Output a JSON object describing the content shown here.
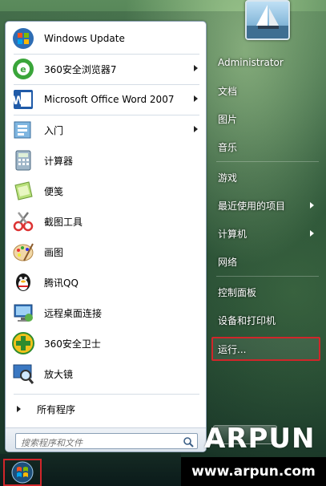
{
  "programs": [
    {
      "label": "Windows Update",
      "icon": "windows-update-icon",
      "has_submenu": false
    },
    {
      "label": "360安全浏览器7",
      "icon": "360-browser-icon",
      "has_submenu": true
    },
    {
      "label": "Microsoft Office Word 2007",
      "icon": "word-icon",
      "has_submenu": true
    },
    {
      "label": "入门",
      "icon": "getting-started-icon",
      "has_submenu": true
    },
    {
      "label": "计算器",
      "icon": "calculator-icon",
      "has_submenu": false
    },
    {
      "label": "便笺",
      "icon": "sticky-notes-icon",
      "has_submenu": false
    },
    {
      "label": "截图工具",
      "icon": "snipping-tool-icon",
      "has_submenu": false
    },
    {
      "label": "画图",
      "icon": "paint-icon",
      "has_submenu": false
    },
    {
      "label": "腾讯QQ",
      "icon": "qq-icon",
      "has_submenu": false
    },
    {
      "label": "远程桌面连接",
      "icon": "remote-desktop-icon",
      "has_submenu": false
    },
    {
      "label": "360安全卫士",
      "icon": "360-safe-icon",
      "has_submenu": false
    },
    {
      "label": "放大镜",
      "icon": "magnifier-icon",
      "has_submenu": false
    }
  ],
  "all_programs_label": "所有程序",
  "search": {
    "placeholder": "搜索程序和文件"
  },
  "right_items": [
    {
      "label": "Administrator",
      "has_submenu": false
    },
    {
      "label": "文档",
      "has_submenu": false
    },
    {
      "label": "图片",
      "has_submenu": false
    },
    {
      "label": "音乐",
      "has_submenu": false
    },
    {
      "label": "游戏",
      "has_submenu": false
    },
    {
      "label": "最近使用的项目",
      "has_submenu": true
    },
    {
      "label": "计算机",
      "has_submenu": true
    },
    {
      "label": "网络",
      "has_submenu": false
    },
    {
      "label": "控制面板",
      "has_submenu": false
    },
    {
      "label": "设备和打印机",
      "has_submenu": false
    },
    {
      "label": "运行...",
      "has_submenu": false
    }
  ],
  "watermark": {
    "big": "ARPUN",
    "url": "www.arpun.com"
  },
  "colors": {
    "highlight": "#d0262a"
  }
}
